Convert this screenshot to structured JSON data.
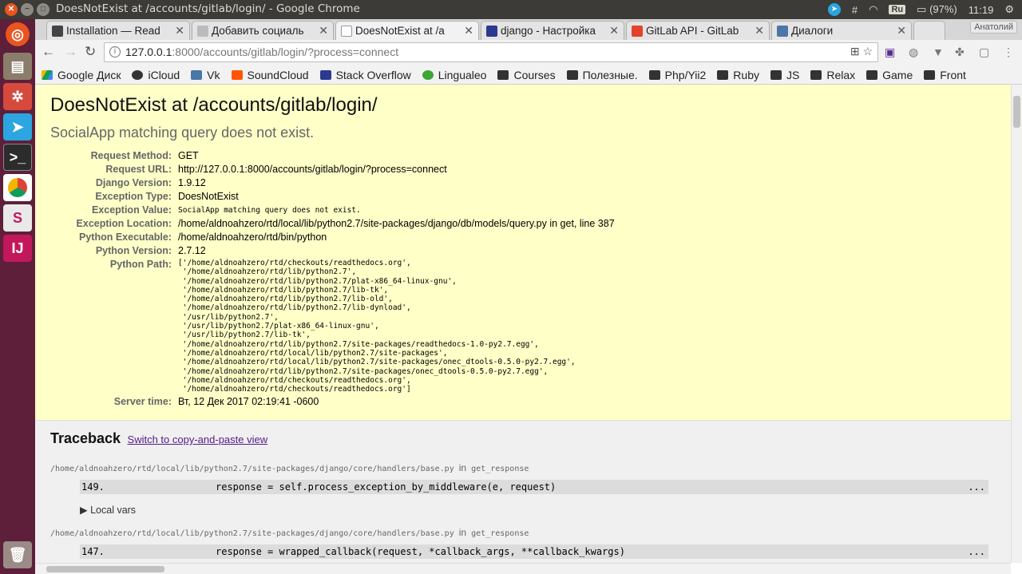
{
  "window": {
    "title": "DoesNotExist at /accounts/gitlab/login/ - Google Chrome"
  },
  "tray": {
    "keyboard": "Ru",
    "battery": "(97%)",
    "time": "11:19"
  },
  "tabs": [
    {
      "label": "Installation — Read",
      "favicon_color": "#444444",
      "active": false
    },
    {
      "label": "Добавить социаль",
      "favicon_color": "#888888",
      "active": false
    },
    {
      "label": "DoesNotExist at /a",
      "favicon_color": "#888888",
      "active": true
    },
    {
      "label": "django - Настройка",
      "favicon_color": "#2b3990",
      "active": false
    },
    {
      "label": "GitLab API - GitLab",
      "favicon_color": "#e24329",
      "active": false
    },
    {
      "label": "Диалоги",
      "favicon_color": "#4a76a8",
      "active": false
    }
  ],
  "profile": "Анатолий",
  "address": {
    "host": "127.0.0.1",
    "rest": ":8000/accounts/gitlab/login/?process=connect"
  },
  "bookmarks": [
    {
      "label": "Google Диск",
      "icon": "google-drive-icon",
      "color": "#1fa463"
    },
    {
      "label": "iCloud",
      "icon": "apple-icon",
      "color": "#333333"
    },
    {
      "label": "Vk",
      "icon": "vk-icon",
      "color": "#4a76a8"
    },
    {
      "label": "SoundCloud",
      "icon": "soundcloud-icon",
      "color": "#ff5500"
    },
    {
      "label": "Stack Overflow",
      "icon": "stackoverflow-icon",
      "color": "#2b3990"
    },
    {
      "label": "Lingualeo",
      "icon": "lingualeo-icon",
      "color": "#3fa535"
    },
    {
      "label": "Courses",
      "icon": "folder-icon",
      "color": "#333333"
    },
    {
      "label": "Полезные.",
      "icon": "folder-icon",
      "color": "#333333"
    },
    {
      "label": "Php/Yii2",
      "icon": "folder-icon",
      "color": "#333333"
    },
    {
      "label": "Ruby",
      "icon": "folder-icon",
      "color": "#333333"
    },
    {
      "label": "JS",
      "icon": "folder-icon",
      "color": "#333333"
    },
    {
      "label": "Relax",
      "icon": "folder-icon",
      "color": "#333333"
    },
    {
      "label": "Game",
      "icon": "folder-icon",
      "color": "#333333"
    },
    {
      "label": "Front",
      "icon": "folder-icon",
      "color": "#333333"
    }
  ],
  "error": {
    "title": "DoesNotExist at /accounts/gitlab/login/",
    "subtitle": "SocialApp matching query does not exist.",
    "meta": [
      {
        "label": "Request Method:",
        "value": "GET"
      },
      {
        "label": "Request URL:",
        "value": "http://127.0.0.1:8000/accounts/gitlab/login/?process=connect"
      },
      {
        "label": "Django Version:",
        "value": "1.9.12"
      },
      {
        "label": "Exception Type:",
        "value": "DoesNotExist"
      },
      {
        "label": "Exception Value:",
        "value": "SocialApp matching query does not exist.",
        "mono": true
      },
      {
        "label": "Exception Location:",
        "value": "/home/aldnoahzero/rtd/local/lib/python2.7/site-packages/django/db/models/query.py in get, line 387"
      },
      {
        "label": "Python Executable:",
        "value": "/home/aldnoahzero/rtd/bin/python"
      },
      {
        "label": "Python Version:",
        "value": "2.7.12"
      },
      {
        "label": "Python Path:",
        "value": "['/home/aldnoahzero/rtd/checkouts/readthedocs.org',\n '/home/aldnoahzero/rtd/lib/python2.7',\n '/home/aldnoahzero/rtd/lib/python2.7/plat-x86_64-linux-gnu',\n '/home/aldnoahzero/rtd/lib/python2.7/lib-tk',\n '/home/aldnoahzero/rtd/lib/python2.7/lib-old',\n '/home/aldnoahzero/rtd/lib/python2.7/lib-dynload',\n '/usr/lib/python2.7',\n '/usr/lib/python2.7/plat-x86_64-linux-gnu',\n '/usr/lib/python2.7/lib-tk',\n '/home/aldnoahzero/rtd/lib/python2.7/site-packages/readthedocs-1.0-py2.7.egg',\n '/home/aldnoahzero/rtd/local/lib/python2.7/site-packages',\n '/home/aldnoahzero/rtd/local/lib/python2.7/site-packages/onec_dtools-0.5.0-py2.7.egg',\n '/home/aldnoahzero/rtd/lib/python2.7/site-packages/onec_dtools-0.5.0-py2.7.egg',\n '/home/aldnoahzero/rtd/checkouts/readthedocs.org',\n '/home/aldnoahzero/rtd/checkouts/readthedocs.org']",
        "mono": true,
        "pre": true
      },
      {
        "label": "Server time:",
        "value": "Вт, 12 Дек 2017 02:19:41 -0600"
      }
    ]
  },
  "traceback": {
    "heading": "Traceback",
    "switch_link": "Switch to copy-and-paste view",
    "in_word": "in",
    "frames": [
      {
        "file": "/home/aldnoahzero/rtd/local/lib/python2.7/site-packages/django/core/handlers/base.py",
        "func": "get_response",
        "lineno": "149.",
        "code": "response = self.process_exception_by_middleware(e, request)",
        "dots": "...",
        "locals_label": "▶ Local vars"
      },
      {
        "file": "/home/aldnoahzero/rtd/local/lib/python2.7/site-packages/django/core/handlers/base.py",
        "func": "get_response",
        "lineno": "147.",
        "code": "response = wrapped_callback(request, *callback_args, **callback_kwargs)",
        "dots": "..."
      }
    ]
  }
}
